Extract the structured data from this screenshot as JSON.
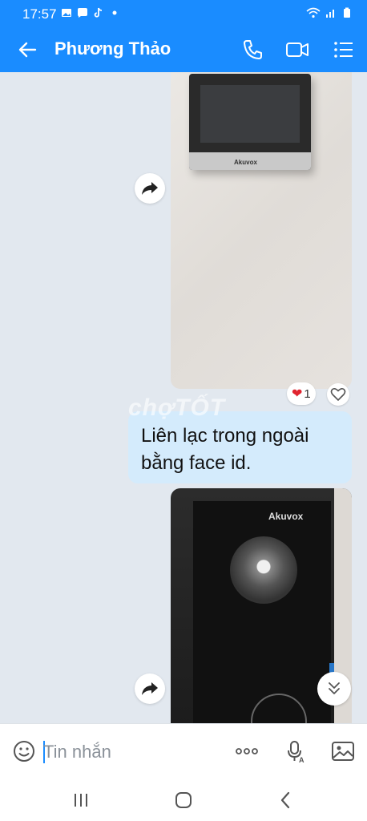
{
  "status": {
    "time": "17:57",
    "left_icons": [
      "image-icon",
      "messenger-icon",
      "tiktok-icon",
      "dot-icon"
    ],
    "right_icons": [
      "wifi-icon",
      "signal-icon",
      "battery-icon"
    ]
  },
  "header": {
    "title": "Phương Thảo",
    "icons": [
      "back-arrow-icon",
      "phone-icon",
      "video-call-icon",
      "menu-icon"
    ]
  },
  "messages": [
    {
      "type": "image",
      "content": "monitor-photo",
      "brand": "Akuvox"
    },
    {
      "type": "reaction",
      "emoji": "❤",
      "count": "1"
    },
    {
      "type": "text",
      "text": "Liên lạc trong ngoài bằng face id."
    },
    {
      "type": "image",
      "content": "doorbell-photo",
      "brand": "Akuvox"
    }
  ],
  "watermark": "chợTỐT",
  "input": {
    "placeholder": "Tin nhắn",
    "value": ""
  },
  "colors": {
    "accent": "#1a8cff",
    "bubble": "#d4ebfc",
    "background": "#e2e8ef"
  }
}
